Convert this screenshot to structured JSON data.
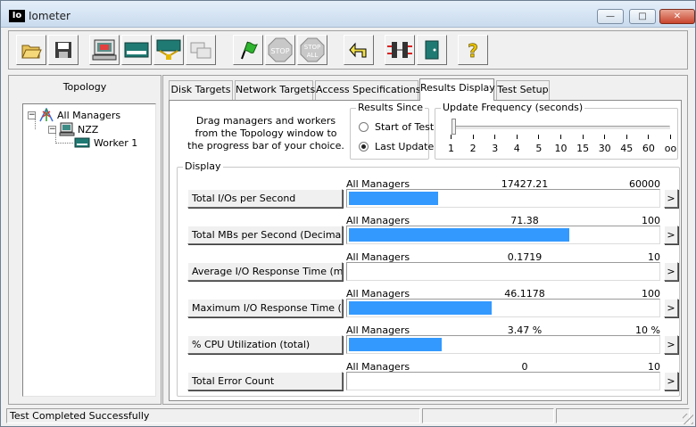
{
  "window": {
    "app_icon_text": "Io",
    "title": "Iometer",
    "controls": {
      "minimize": "—",
      "maximize": "□",
      "close": "✕"
    }
  },
  "toolbar": {
    "buttons": [
      {
        "icon": "open-folder-icon"
      },
      {
        "icon": "save-disk-icon"
      },
      {
        "icon": "new-worker-icon"
      },
      {
        "icon": "new-manager-icon"
      },
      {
        "icon": "network-worker-icon"
      },
      {
        "icon": "copy-worker-icon"
      },
      {
        "icon": "start-flag-icon"
      },
      {
        "icon": "stop-icon",
        "label": "STOP"
      },
      {
        "icon": "stop-all-icon",
        "label": "STOP",
        "sublabel": "ALL"
      },
      {
        "icon": "reset-workers-icon"
      },
      {
        "icon": "disconnect-icon"
      },
      {
        "icon": "exit-door-icon"
      },
      {
        "icon": "help-icon",
        "label": "?"
      }
    ]
  },
  "topology": {
    "title": "Topology",
    "tree": [
      {
        "label": "All Managers",
        "expander": "−",
        "icon": "all-managers-icon"
      },
      {
        "label": "NZZ",
        "expander": "−",
        "icon": "manager-computer-icon"
      },
      {
        "label": "Worker 1",
        "icon": "worker-disk-icon"
      }
    ]
  },
  "tabs": [
    {
      "label": "Disk Targets",
      "active": false
    },
    {
      "label": "Network Targets",
      "active": false
    },
    {
      "label": "Access Specifications",
      "active": false
    },
    {
      "label": "Results Display",
      "active": true
    },
    {
      "label": "Test Setup",
      "active": false
    }
  ],
  "results": {
    "instructions": "Drag managers and workers from the Topology window to the progress bar of your choice.",
    "results_since": {
      "label": "Results Since",
      "options": [
        {
          "label": "Start of Test",
          "selected": false
        },
        {
          "label": "Last Update",
          "selected": true
        }
      ]
    },
    "update_frequency": {
      "label": "Update Frequency (seconds)",
      "ticks": [
        "1",
        "2",
        "3",
        "4",
        "5",
        "10",
        "15",
        "30",
        "45",
        "60",
        "oo"
      ],
      "selected": "1"
    },
    "display": {
      "label": "Display",
      "metrics": [
        {
          "name": "Total I/Os per Second",
          "target": "All Managers",
          "value": "17427.21",
          "max": "60000",
          "fill_fraction": 0.29
        },
        {
          "name": "Total MBs per Second (Decimal)",
          "target": "All Managers",
          "value": "71.38",
          "max": "100",
          "fill_fraction": 0.7138
        },
        {
          "name": "Average I/O Response Time (ms)",
          "target": "All Managers",
          "value": "0.1719",
          "max": "10",
          "fill_fraction": 0.0
        },
        {
          "name": "Maximum I/O Response Time (ms)",
          "target": "All Managers",
          "value": "46.1178",
          "max": "100",
          "fill_fraction": 0.4612
        },
        {
          "name": "% CPU Utilization (total)",
          "target": "All Managers",
          "value": "3.47 %",
          "max": "10 %",
          "fill_fraction": 0.3
        },
        {
          "name": "Total Error Count",
          "target": "All Managers",
          "value": "0",
          "max": "10",
          "fill_fraction": 0.0
        }
      ],
      "arrow": ">"
    }
  },
  "status": {
    "message": "Test Completed Successfully"
  },
  "colors": {
    "bar": "#3399ff",
    "titlebar": "#c9dbee",
    "window": "#f0f0f0"
  }
}
